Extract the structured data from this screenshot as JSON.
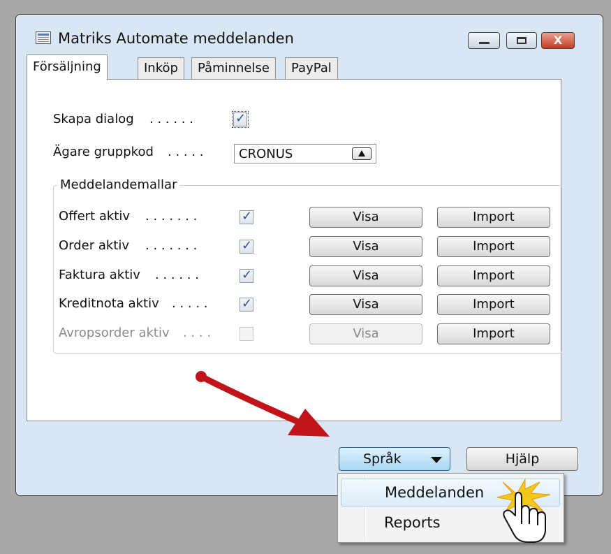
{
  "window": {
    "title": "Matriks Automate meddelanden",
    "controls": {
      "minimize": "minimize",
      "maximize": "maximize",
      "close": "X"
    }
  },
  "tabs": [
    {
      "label": "Försäljning",
      "active": true
    },
    {
      "label": "Inköp",
      "active": false
    },
    {
      "label": "Påminnelse",
      "active": false
    },
    {
      "label": "PayPal",
      "active": false
    }
  ],
  "form": {
    "skapa_dialog": {
      "label": "Skapa dialog",
      "dots": ". . . . . .",
      "checked": true
    },
    "agare_gruppkod": {
      "label": "Ägare gruppkod",
      "dots": ". . . . .",
      "value": "CRONUS"
    }
  },
  "group": {
    "title": "Meddelandemallar",
    "rows": [
      {
        "label": "Offert aktiv",
        "dots": ". . . . . . .",
        "checked": true,
        "enabled": true,
        "visa": "Visa",
        "import": "Import"
      },
      {
        "label": "Order aktiv",
        "dots": ". . . . . . .",
        "checked": true,
        "enabled": true,
        "visa": "Visa",
        "import": "Import"
      },
      {
        "label": "Faktura aktiv",
        "dots": ". . . . . .",
        "checked": true,
        "enabled": true,
        "visa": "Visa",
        "import": "Import"
      },
      {
        "label": "Kreditnota aktiv",
        "dots": ". . . . .",
        "checked": true,
        "enabled": true,
        "visa": "Visa",
        "import": "Import"
      },
      {
        "label": "Avropsorder aktiv",
        "dots": ". . . .",
        "checked": false,
        "enabled": false,
        "visa": "Visa",
        "import": "Import"
      }
    ]
  },
  "buttons": {
    "sprak": "Språk",
    "hjalp": "Hjälp"
  },
  "dropdown_menu": {
    "items": [
      {
        "label": "Meddelanden",
        "highlighted": true
      },
      {
        "label": "Reports",
        "highlighted": false
      }
    ]
  },
  "colors": {
    "annotation_arrow": "#c0141a",
    "click_burst": "#f2c81a",
    "button_active": "#a9d8f3"
  }
}
